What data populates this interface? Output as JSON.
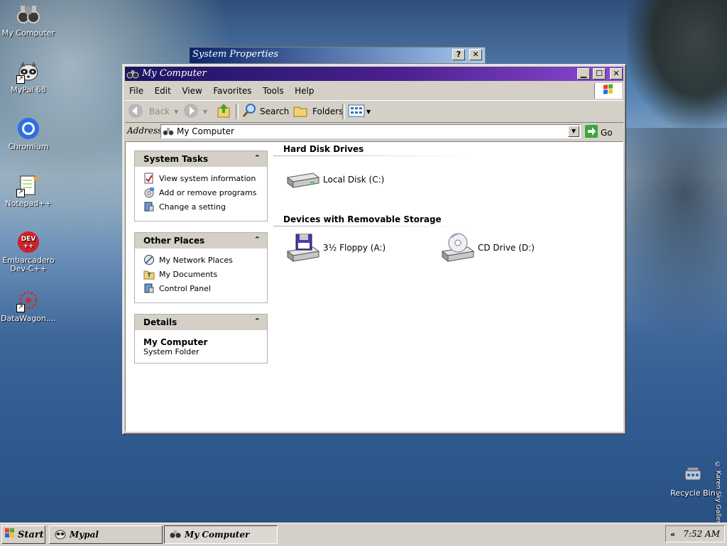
{
  "desktop": {
    "icons": [
      {
        "label": "My Computer",
        "icon": "binoculars-icon"
      },
      {
        "label": "MyPal 68",
        "icon": "raccoon-icon"
      },
      {
        "label": "Chromium",
        "icon": "chromium-icon"
      },
      {
        "label": "Notepad++",
        "icon": "notepad-icon"
      },
      {
        "label": "Embarcadero Dev-C++",
        "icon": "devcpp-icon"
      },
      {
        "label": "DataWagon....",
        "icon": "datawagon-icon"
      },
      {
        "label": "Recycle Bin",
        "icon": "recycle-bin-icon"
      }
    ],
    "credit": "© Karen Sky Gallery"
  },
  "system_properties": {
    "title": "System Properties",
    "help_label": "?",
    "close_label": "✕"
  },
  "window": {
    "title": "My Computer",
    "controls": {
      "minimize": "▁",
      "maximize": "☐",
      "close": "✕"
    },
    "menu": [
      "File",
      "Edit",
      "View",
      "Favorites",
      "Tools",
      "Help"
    ],
    "toolbar": {
      "back": "Back",
      "search": "Search",
      "folders": "Folders"
    },
    "address": {
      "label": "Address",
      "value": "My Computer",
      "go": "Go"
    },
    "panes": {
      "system_tasks": {
        "title": "System Tasks",
        "items": [
          "View system information",
          "Add or remove programs",
          "Change a setting"
        ]
      },
      "other_places": {
        "title": "Other Places",
        "items": [
          "My Network Places",
          "My Documents",
          "Control Panel"
        ]
      },
      "details": {
        "title": "Details",
        "name": "My Computer",
        "type": "System Folder"
      }
    },
    "groups": {
      "hard_disks": {
        "title": "Hard Disk Drives",
        "drives": [
          "Local Disk (C:)"
        ]
      },
      "removable": {
        "title": "Devices with Removable Storage",
        "drives": [
          "3½ Floppy (A:)",
          "CD Drive (D:)"
        ]
      }
    }
  },
  "taskbar": {
    "start": "Start",
    "tasks": [
      "Mypal",
      "My Computer"
    ],
    "tray_arrow": "«",
    "clock": "7:52 AM"
  },
  "colors": {
    "titlebar_start": "#1a1560",
    "titlebar_end": "#8c4bd0",
    "face": "#d4d0c8"
  }
}
